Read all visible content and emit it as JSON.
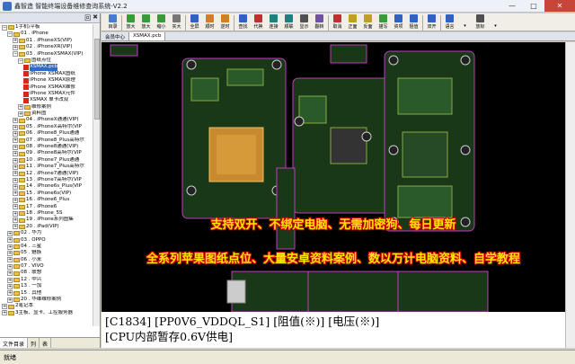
{
  "window": {
    "title": "鑫智造 智能终端设备维修查询系统-V2.2",
    "min": "—",
    "max": "□",
    "close": "✕"
  },
  "left_panel": {
    "header_btns": [
      "回",
      "✖"
    ],
    "tree": [
      {
        "indent": 0,
        "exp": "−",
        "icon": "fold",
        "label": "1手机\\平板"
      },
      {
        "indent": 1,
        "exp": "−",
        "icon": "fold",
        "label": "01 . iPhone"
      },
      {
        "indent": 2,
        "exp": "+",
        "icon": "fold",
        "label": "01 . iPhoneXS(VIP)"
      },
      {
        "indent": 2,
        "exp": "+",
        "icon": "fold",
        "label": "02 . iPhoneXR(VIP)"
      },
      {
        "indent": 2,
        "exp": "−",
        "icon": "fold",
        "label": "03 . iPhoneXSMAX(VIP)"
      },
      {
        "indent": 3,
        "exp": "−",
        "icon": "fold",
        "label": "图纸点位"
      },
      {
        "indent": 4,
        "exp": "",
        "icon": "pdf",
        "label": "XSMAX.pcb",
        "sel": true
      },
      {
        "indent": 4,
        "exp": "",
        "icon": "pdf",
        "label": "iPhone XSMAX图纸"
      },
      {
        "indent": 4,
        "exp": "",
        "icon": "pdf",
        "label": "iPhone XSMAX原理"
      },
      {
        "indent": 4,
        "exp": "",
        "icon": "pdf",
        "label": "iPhone XSMAX维修"
      },
      {
        "indent": 4,
        "exp": "",
        "icon": "pdf",
        "label": "iPhone XSMAX元件"
      },
      {
        "indent": 4,
        "exp": "",
        "icon": "pdf",
        "label": "XSMAX 单卡改双"
      },
      {
        "indent": 3,
        "exp": "+",
        "icon": "fold",
        "label": "维修案例"
      },
      {
        "indent": 3,
        "exp": "+",
        "icon": "fold",
        "label": "资料图"
      },
      {
        "indent": 2,
        "exp": "+",
        "icon": "fold",
        "label": "04 . iPhoneX通通(VIP)"
      },
      {
        "indent": 2,
        "exp": "+",
        "icon": "fold",
        "label": "05 . iPhoneX高特尔(VIP"
      },
      {
        "indent": 2,
        "exp": "+",
        "icon": "fold",
        "label": "06 . iPhone8_Plus通通"
      },
      {
        "indent": 2,
        "exp": "+",
        "icon": "fold",
        "label": "07 . iPhone8_Plus高特尔"
      },
      {
        "indent": 2,
        "exp": "+",
        "icon": "fold",
        "label": "08 . iPhone8通通(VIP)"
      },
      {
        "indent": 2,
        "exp": "+",
        "icon": "fold",
        "label": "09 . iPhone8高特尔(VIP"
      },
      {
        "indent": 2,
        "exp": "+",
        "icon": "fold",
        "label": "10 . iPhone7_Plus通通"
      },
      {
        "indent": 2,
        "exp": "+",
        "icon": "fold",
        "label": "11 . iPhone7_Plus高特尔"
      },
      {
        "indent": 2,
        "exp": "+",
        "icon": "fold",
        "label": "12 . iPhone7通通(VIP)"
      },
      {
        "indent": 2,
        "exp": "+",
        "icon": "fold",
        "label": "13 . iPhone7高特尔(VIP"
      },
      {
        "indent": 2,
        "exp": "+",
        "icon": "fold",
        "label": "14 . iPhone6s_Plus(VIP"
      },
      {
        "indent": 2,
        "exp": "+",
        "icon": "fold",
        "label": "15 . iPhone6s(VIP)"
      },
      {
        "indent": 2,
        "exp": "+",
        "icon": "fold",
        "label": "16 . iPhone6_Plus"
      },
      {
        "indent": 2,
        "exp": "+",
        "icon": "fold",
        "label": "17 . iPhone6"
      },
      {
        "indent": 2,
        "exp": "+",
        "icon": "fold",
        "label": "18 . iPhone_5S"
      },
      {
        "indent": 2,
        "exp": "+",
        "icon": "fold",
        "label": "19 . iPhone系列图集"
      },
      {
        "indent": 2,
        "exp": "+",
        "icon": "fold",
        "label": "20 . iPad(VIP)"
      },
      {
        "indent": 1,
        "exp": "+",
        "icon": "fold",
        "label": "02 . 华为"
      },
      {
        "indent": 1,
        "exp": "+",
        "icon": "fold",
        "label": "03 . OPPO"
      },
      {
        "indent": 1,
        "exp": "+",
        "icon": "fold",
        "label": "04 . 三星"
      },
      {
        "indent": 1,
        "exp": "+",
        "icon": "fold",
        "label": "05 . 魅族"
      },
      {
        "indent": 1,
        "exp": "+",
        "icon": "fold",
        "label": "06 . 小米"
      },
      {
        "indent": 1,
        "exp": "+",
        "icon": "fold",
        "label": "07 . VIVO"
      },
      {
        "indent": 1,
        "exp": "+",
        "icon": "fold",
        "label": "08 . 联想"
      },
      {
        "indent": 1,
        "exp": "+",
        "icon": "fold",
        "label": "12 . 中兴"
      },
      {
        "indent": 1,
        "exp": "+",
        "icon": "fold",
        "label": "13 . 一加"
      },
      {
        "indent": 1,
        "exp": "+",
        "icon": "fold",
        "label": "15 . 其他"
      },
      {
        "indent": 1,
        "exp": "+",
        "icon": "fold",
        "label": "20 . 华维维修案例"
      },
      {
        "indent": 0,
        "exp": "+",
        "icon": "fold",
        "label": "2笔记本"
      },
      {
        "indent": 0,
        "exp": "+",
        "icon": "fold",
        "label": "3主板、显卡、工控服务器"
      }
    ],
    "tabs": [
      "文件目录",
      "列",
      "表"
    ]
  },
  "toolbar": [
    {
      "label": "目录",
      "color": "#4a7bd0"
    },
    {
      "sep": true
    },
    {
      "label": "放大",
      "color": "#3a9a3a"
    },
    {
      "label": "放大",
      "color": "#3a9a3a"
    },
    {
      "label": "缩小",
      "color": "#3a9a3a"
    },
    {
      "label": "实大",
      "color": "#777777"
    },
    {
      "sep": true
    },
    {
      "label": "全屏",
      "color": "#3060c0"
    },
    {
      "label": "顺时",
      "color": "#d08020"
    },
    {
      "label": "逆时",
      "color": "#d08020"
    },
    {
      "sep": true
    },
    {
      "label": "查找",
      "color": "#3060c0"
    },
    {
      "label": "代换",
      "color": "#c03030"
    },
    {
      "label": "连接",
      "color": "#208080"
    },
    {
      "label": "顺联",
      "color": "#208080"
    },
    {
      "label": "显示",
      "color": "#505050"
    },
    {
      "label": "翻转",
      "color": "#7050a0"
    },
    {
      "sep": true
    },
    {
      "label": "取消",
      "color": "#c03030"
    },
    {
      "label": "正面",
      "color": "#c0a020"
    },
    {
      "label": "反面",
      "color": "#c0a020"
    },
    {
      "label": "描写",
      "color": "#3a9a3a"
    },
    {
      "label": "资项",
      "color": "#3060c0"
    },
    {
      "label": "阻值",
      "color": "#3060c0"
    },
    {
      "sep": true
    },
    {
      "label": "双开",
      "color": "#3060c0"
    },
    {
      "sep": true
    },
    {
      "label": "语言",
      "color": "#3060c0"
    },
    {
      "label": "▾",
      "color": "#f0eee6"
    },
    {
      "label": "放标",
      "color": "#505050"
    },
    {
      "label": "▾",
      "color": "#f0eee6"
    }
  ],
  "doc_tabs": [
    "会员中心",
    "XSMAX.pcb"
  ],
  "promo": {
    "line1": "支持双开、不绑定电脑、无需加密狗、每日更新",
    "line2": "全系列苹果图纸点位、大量安卓资料案例、数以万计电脑资料、自学教程"
  },
  "info": {
    "line1": "[C1834] [PP0V6_VDDQL_S1] [阻值(※)] [电压(※)]",
    "line2": "[CPU内部暂存0.6V供电]"
  },
  "status": {
    "text": "就绪"
  },
  "colors": {
    "board": "#1a3a1a",
    "outline": "#c03cc0",
    "cpu": "#d69a3a",
    "promo_text": "#ffe600",
    "promo_outline": "#cc0000"
  }
}
